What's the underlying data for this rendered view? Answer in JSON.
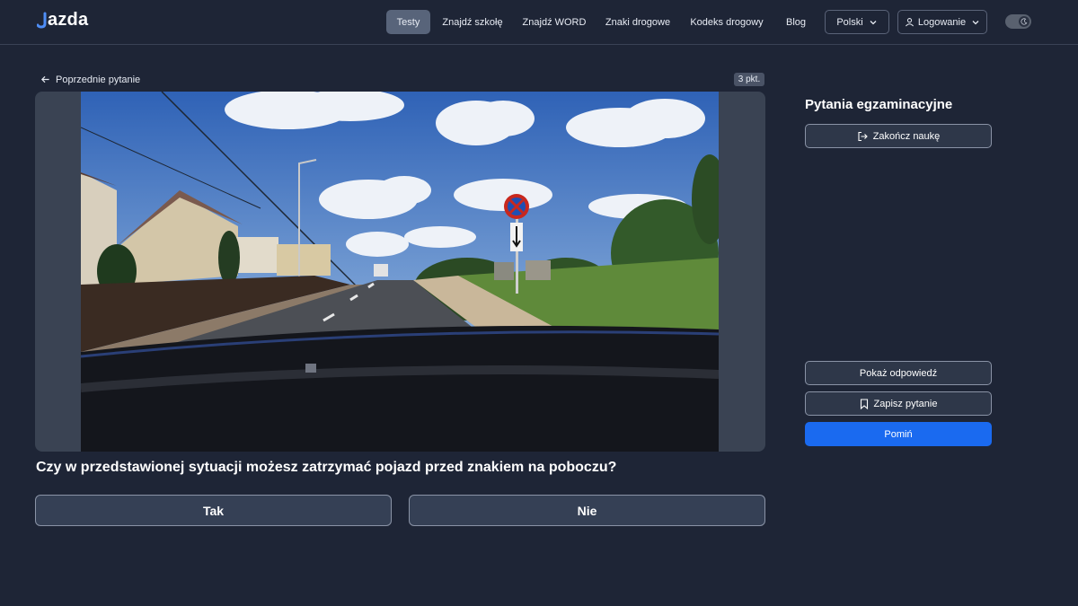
{
  "header": {
    "logo": "azda",
    "nav": [
      "Testy",
      "Znajdź szkołę",
      "Znajdź WORD",
      "Znaki drogowe",
      "Kodeks drogowy",
      "Blog"
    ],
    "active_nav": "Testy",
    "language": "Polski",
    "login": "Logowanie"
  },
  "question": {
    "prev_label": "Poprzednie pytanie",
    "points": "3 pkt.",
    "text": "Czy w przedstawionej sytuacji możesz zatrzymać pojazd przed znakiem na poboczu?",
    "answers": [
      "Tak",
      "Nie"
    ]
  },
  "sidebar": {
    "title": "Pytania egzaminacyjne",
    "finish_label": "Zakończ naukę",
    "show_answer_label": "Pokaż odpowiedź",
    "save_label": "Zapisz pytanie",
    "skip_label": "Pomiń"
  },
  "colors": {
    "background": "#1e2536",
    "primary": "#1a6af0",
    "logo_accent": "#4f8ef7"
  }
}
